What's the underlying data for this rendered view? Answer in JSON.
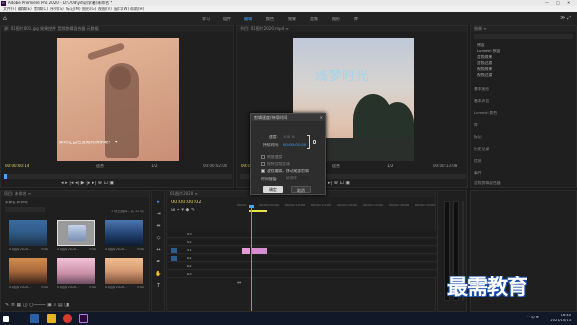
{
  "window": {
    "title": "Adobe Premiere Pro 2020 - D:\\70d\\yd\\初学者\\未命名 *",
    "controls": [
      "—",
      "□",
      "✕"
    ]
  },
  "menu": [
    "文件(F)",
    "编辑(E)",
    "剪辑(C)",
    "序列(S)",
    "标记(M)",
    "图形(G)",
    "视图(V)",
    "窗口(W)",
    "帮助(H)"
  ],
  "workspaces": {
    "items": [
      "学习",
      "组件",
      "编辑",
      "颜色",
      "效果",
      "音频",
      "图形",
      "库"
    ],
    "active_index": 2
  },
  "source_monitor": {
    "header": "源: 01图片001.jpg  效果控件  音频剪辑混合器  元数据",
    "caption_text": "如何让自己变成有快乐呢？ ✦",
    "timecode_left": "00:00:00:14",
    "timecode_right": "00:00:02:00",
    "fit_label": "适合",
    "page_label": "1/2",
    "controls": "◂  ▸  |◂  ◂|  ▶  |▸  ▸|  ⊕  ⊡  ▣"
  },
  "program_monitor": {
    "header": "节目: 01图片2020.mp4 ≡",
    "title_text": "浅梦时光",
    "timecode_left": "00:00:00:00",
    "timecode_right": "00:00:13:08",
    "fit_label": "适合",
    "page_label": "1/2",
    "controls": "◂  ▸  |◂  ◂|  ▶  |▸  ▸|  ⊕  ⊡  ▣"
  },
  "effects_panel": {
    "header": "效果  ≡",
    "items": [
      "预设",
      "Lumetri 预设",
      "音频效果",
      "音频过渡",
      "视频效果",
      "视频过渡"
    ],
    "right_list": [
      "基本图形",
      "基本声音",
      "Lumetri 颜色",
      "库",
      "标记",
      "历史记录",
      "信息",
      "事件",
      "音频剪辑混合器",
      "音轨混合器",
      "效果控件",
      "元数据",
      "工作区",
      "捕捉"
    ]
  },
  "dialog": {
    "title": "剪辑速度/持续时间",
    "speed_label": "速度:",
    "speed_value": "100 %",
    "duration_label": "持续时间:",
    "duration_value": "00:00:01:00",
    "reverse_label": "倒放速度",
    "keep_pitch_label": "保持音频音调",
    "ripple_label": "波纹编辑，移动尾部剪辑",
    "interp_label": "时间插值:",
    "interp_value": "帧采样",
    "ok": "确定",
    "cancel": "取消"
  },
  "project_panel": {
    "header": "项目: 未命名  ≡",
    "path": "未命名.prproj",
    "count_label": "1 项已选择，共 12 项",
    "thumbs": [
      {
        "label": "01图片2020...",
        "dur": "5:00",
        "color": "#2f5a86"
      },
      {
        "label": "01图片2020...",
        "dur": "5:00",
        "color": "#7a8fb5"
      },
      {
        "label": "01图片2020...",
        "dur": "5:00",
        "color": "#1f3d6a"
      },
      {
        "label": "01图片2020...",
        "dur": "5:00",
        "color": "#a86a3e"
      },
      {
        "label": "01图片2020...",
        "dur": "5:00",
        "color": "#c98fa6"
      },
      {
        "label": "01图片2020...",
        "dur": "5:00",
        "color": "#d49a72"
      }
    ]
  },
  "timeline": {
    "header": "01图片2020  ≡",
    "timecode": "00:00:00:02",
    "ruler": [
      "00:00",
      "00:00:05:00",
      "00:00:10:00",
      "00:00:15:00",
      "00:00:20:00",
      "00:00:25:00",
      "00:00:30:00",
      "00:00:35:00"
    ],
    "tracks": [
      "V3",
      "V2",
      "V1",
      "A1",
      "A2",
      "A3"
    ]
  },
  "taskbar": {
    "clock_time": "16:40",
    "clock_date": "2021/10/13",
    "tray": "^ 中 ⊕"
  },
  "watermark": "最需教育"
}
